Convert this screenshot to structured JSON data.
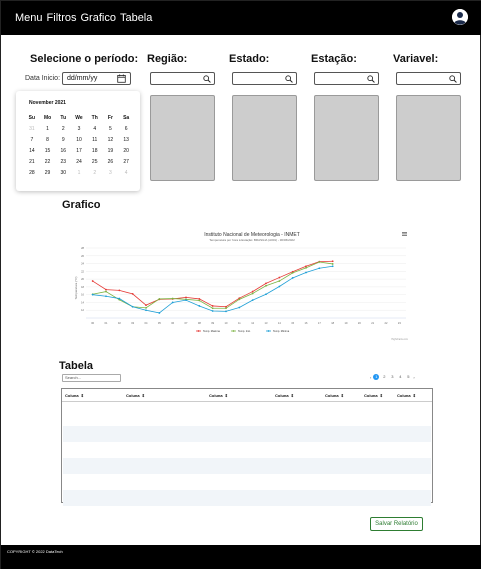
{
  "nav": {
    "items": [
      "Menu",
      "Filtros",
      "Grafico",
      "Tabela"
    ]
  },
  "filters": {
    "period_title": "Selecione o período:",
    "date_label": "Data Inicio:",
    "date_placeholder": "dd/mm/yy",
    "region_title": "Região:",
    "state_title": "Estado:",
    "station_title": "Estação:",
    "variable_title": "Variavel:"
  },
  "calendar": {
    "month_label": "November 2021",
    "weekdays": [
      "Su",
      "Mo",
      "Tu",
      "We",
      "Th",
      "Fr",
      "Sa"
    ],
    "days": [
      {
        "d": "31",
        "muted": true
      },
      {
        "d": "1"
      },
      {
        "d": "2"
      },
      {
        "d": "3"
      },
      {
        "d": "4"
      },
      {
        "d": "5"
      },
      {
        "d": "6"
      },
      {
        "d": "7"
      },
      {
        "d": "8"
      },
      {
        "d": "9"
      },
      {
        "d": "10"
      },
      {
        "d": "11"
      },
      {
        "d": "12"
      },
      {
        "d": "13"
      },
      {
        "d": "14"
      },
      {
        "d": "15"
      },
      {
        "d": "16"
      },
      {
        "d": "17"
      },
      {
        "d": "18"
      },
      {
        "d": "19"
      },
      {
        "d": "20"
      },
      {
        "d": "21"
      },
      {
        "d": "22"
      },
      {
        "d": "23"
      },
      {
        "d": "24"
      },
      {
        "d": "25"
      },
      {
        "d": "26"
      },
      {
        "d": "27"
      },
      {
        "d": "28"
      },
      {
        "d": "29"
      },
      {
        "d": "30"
      },
      {
        "d": "1",
        "muted": true
      },
      {
        "d": "2",
        "muted": true
      },
      {
        "d": "3",
        "muted": true
      },
      {
        "d": "4",
        "muted": true
      }
    ]
  },
  "chart_section": {
    "title": "Grafico"
  },
  "chart_data": {
    "type": "line",
    "title": "Instituto Nacional de Meteorologia - INMET",
    "subtitle": "Temperatura por hora à Estação: BRASILIA (A001) - 30/06/2022",
    "ylabel": "Temperatura (°C)",
    "credits": "Highcharts.com",
    "menu_icon": "hamburger-icon",
    "ylim": [
      10,
      28
    ],
    "yticks": [
      12,
      14,
      16,
      18,
      20,
      22,
      24,
      26,
      28
    ],
    "categories": [
      "00",
      "01",
      "02",
      "03",
      "04",
      "05",
      "06",
      "07",
      "08",
      "09",
      "10",
      "11",
      "12",
      "13",
      "14",
      "15",
      "16",
      "17",
      "18",
      "19",
      "20",
      "21",
      "22",
      "23"
    ],
    "series": [
      {
        "name": "Temp. Maxima",
        "color": "#e53935",
        "values": [
          19.5,
          17.3,
          17.1,
          16.2,
          13.3,
          14.8,
          14.9,
          15.3,
          14.9,
          13.1,
          12.9,
          15.1,
          16.8,
          18.9,
          20.4,
          21.9,
          23.3,
          24.5,
          24.6
        ]
      },
      {
        "name": "Temp. Inst.",
        "color": "#7cb342",
        "values": [
          16.1,
          16.8,
          14.7,
          12.9,
          12.6,
          14.9,
          15.0,
          14.8,
          14.5,
          12.5,
          12.5,
          14.8,
          16.3,
          18.3,
          19.5,
          21.6,
          22.9,
          24.4,
          23.9
        ]
      },
      {
        "name": "Temp. Minima",
        "color": "#1e9fd6",
        "values": [
          16.0,
          15.6,
          15.0,
          12.9,
          12.0,
          11.3,
          14.0,
          14.6,
          13.1,
          11.8,
          11.7,
          12.7,
          14.6,
          16.1,
          18.1,
          20.3,
          21.7,
          22.8,
          23.3
        ]
      }
    ],
    "legend_position": "bottom-center",
    "grid": true
  },
  "table_section": {
    "title": "Tabela",
    "search_placeholder": "Search...",
    "pager": {
      "prev": "‹",
      "pages": [
        "1",
        "2",
        "3",
        "4",
        "5"
      ],
      "active": "1",
      "next": "›"
    },
    "columns": [
      "Coluna",
      "Coluna",
      "Coluna",
      "Coluna",
      "Coluna",
      "Coluna",
      "Coluna"
    ],
    "sort_glyph": "⇕",
    "rows": 5
  },
  "actions": {
    "save_label": "Salvar Relatório"
  },
  "footer": {
    "copyright": "COPYRIGHT © 2022 DataTech"
  },
  "colors": {
    "topbar": "#000000",
    "accent_green": "#2e7d32",
    "pager_active": "#2196f3"
  }
}
